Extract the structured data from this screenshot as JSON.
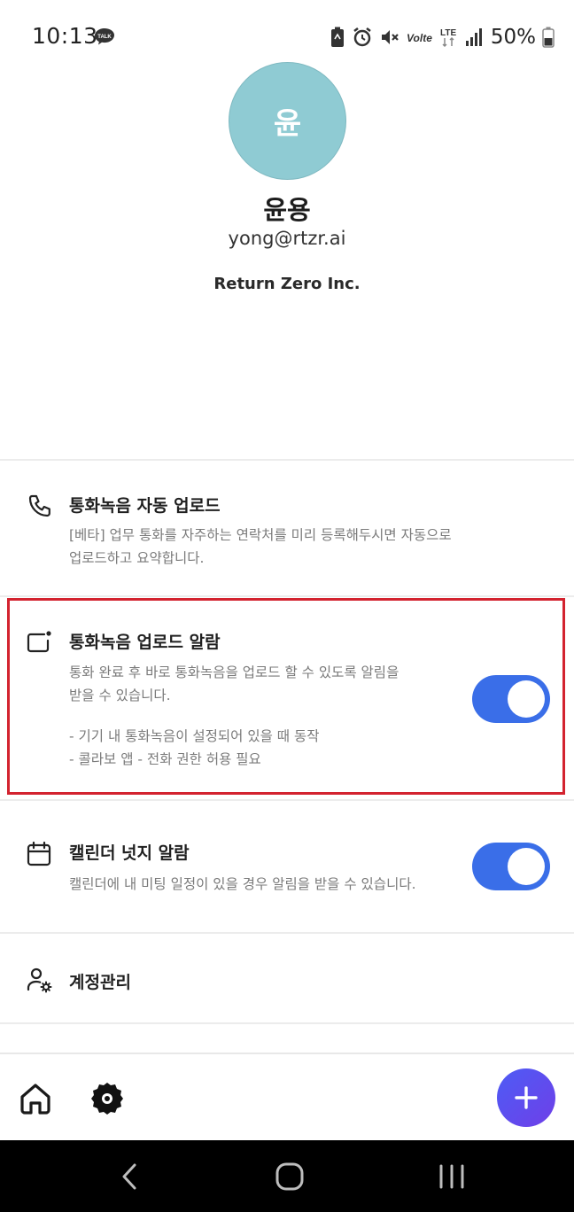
{
  "status_bar": {
    "time": "10:13",
    "talk_badge": "TALK",
    "volte": "Volte",
    "network": "LTE",
    "battery": "50%"
  },
  "profile": {
    "initial": "윤",
    "name": "윤용",
    "email": "yong@rtzr.ai",
    "organization": "Return Zero Inc.",
    "avatar_color": "#8fcbd3"
  },
  "settings": [
    {
      "icon": "phone-icon",
      "title": "통화녹음 자동 업로드",
      "description": "[베타] 업무 통화를 자주하는 연락처를 미리 등록해두시면 자동으로\n업로드하고 요약합니다."
    },
    {
      "icon": "notification-icon",
      "title": "통화녹음 업로드 알람",
      "description": "통화 완료 후 바로 통화녹음을 업로드 할 수 있도록 알림을\n받을 수 있습니다.",
      "notes": "- 기기 내 통화녹음이 설정되어 있을 때 동작\n- 콜라보 앱 - 전화 권한 허용 필요",
      "enabled": true,
      "highlighted": true
    },
    {
      "icon": "calendar-icon",
      "title": "캘린더 넛지 알람",
      "description": "캘린더에 내 미팅 일정이 있을 경우 알림을 받을 수 있습니다.",
      "enabled": true
    },
    {
      "icon": "account-settings-icon",
      "title": "계정관리"
    }
  ],
  "bottom_nav": {
    "items": [
      "home-icon",
      "settings-icon"
    ],
    "fab_icon": "plus-icon"
  },
  "colors": {
    "toggle_on": "#3a6ee8",
    "highlight": "#d3232f",
    "fab_start": "#4d5cf5",
    "fab_end": "#6f3fe8"
  }
}
